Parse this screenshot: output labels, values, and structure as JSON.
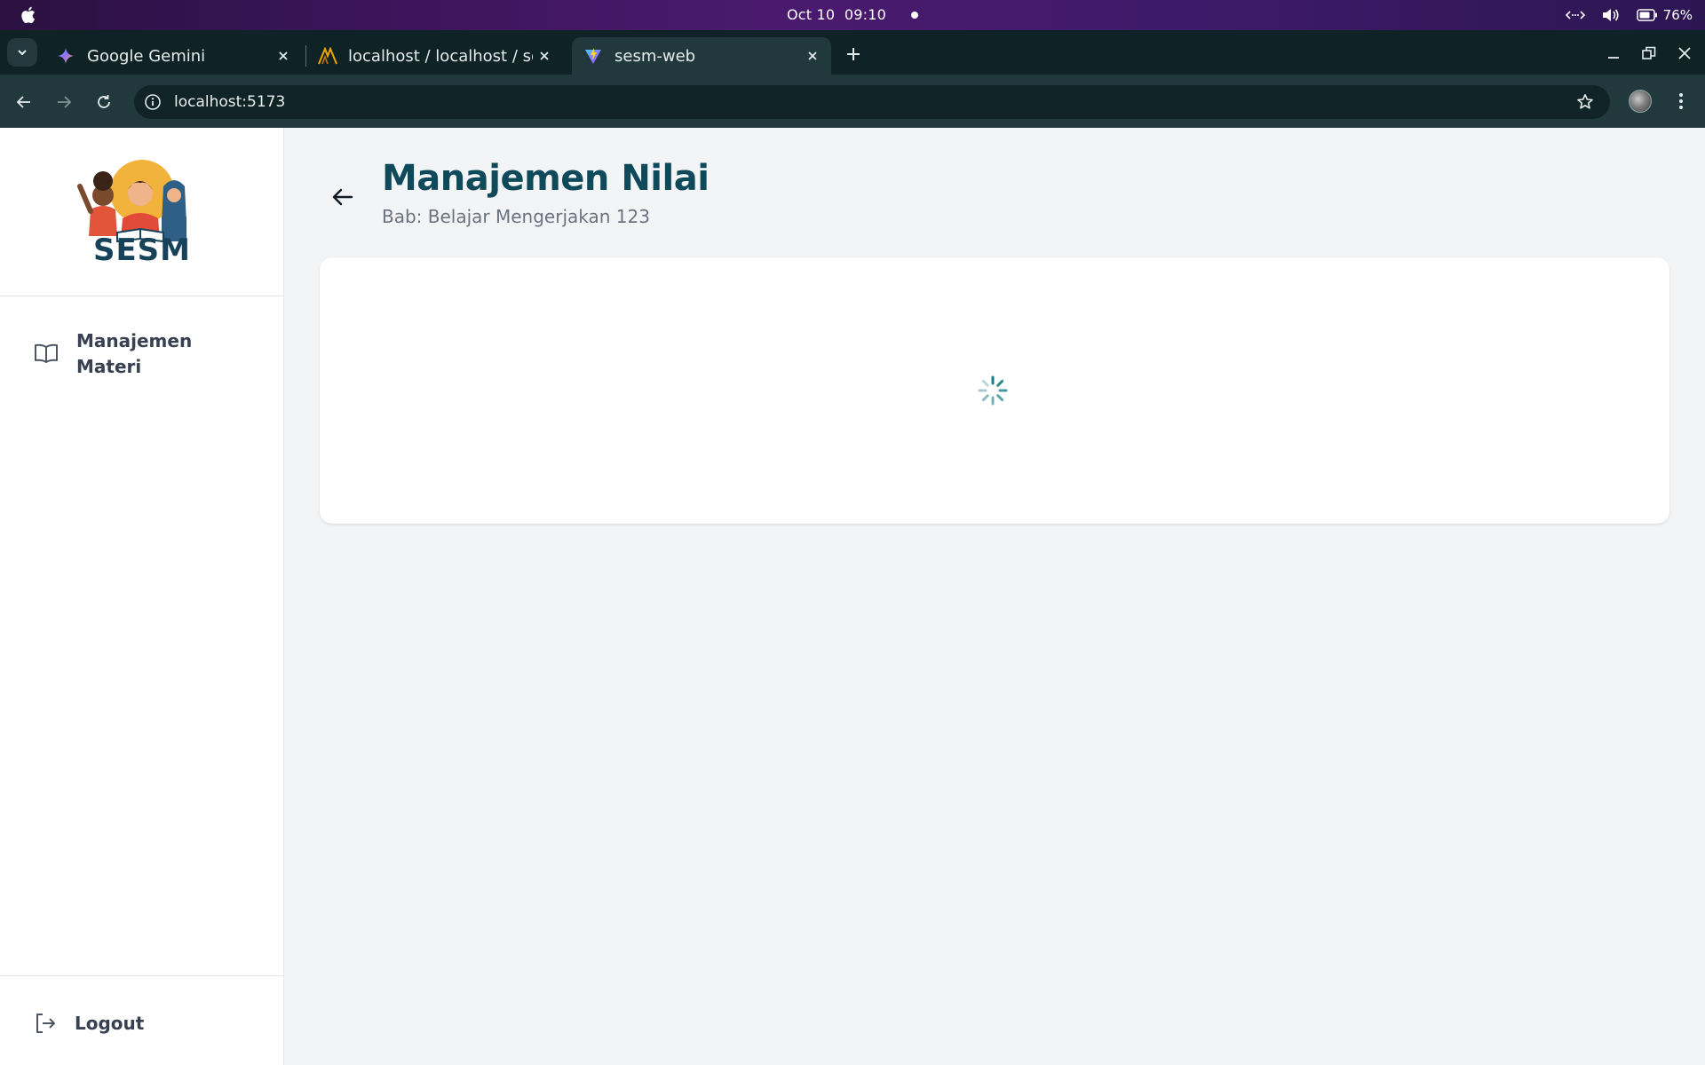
{
  "os": {
    "date": "Oct 10",
    "time": "09:10",
    "battery": "76%"
  },
  "browser": {
    "tabs": [
      {
        "title": "Google Gemini",
        "icon": "gemini-icon",
        "active": false
      },
      {
        "title": "localhost / localhost / ses",
        "icon": "phpmyadmin-icon",
        "active": false
      },
      {
        "title": "sesm-web",
        "icon": "vite-icon",
        "active": true
      }
    ],
    "url": "localhost:5173"
  },
  "sidebar": {
    "logo_text": "SESM",
    "nav_items": [
      {
        "label": "Manajemen Materi",
        "icon": "book-open-icon"
      }
    ],
    "logout_label": "Logout"
  },
  "main": {
    "title": "Manajemen Nilai",
    "subtitle": "Bab: Belajar Mengerjakan 123",
    "loading": true
  },
  "colors": {
    "primary": "#0f4a5b",
    "accent": "#1b7f86",
    "sidebar_bg": "#ffffff",
    "page_bg": "#f3f4f6"
  }
}
